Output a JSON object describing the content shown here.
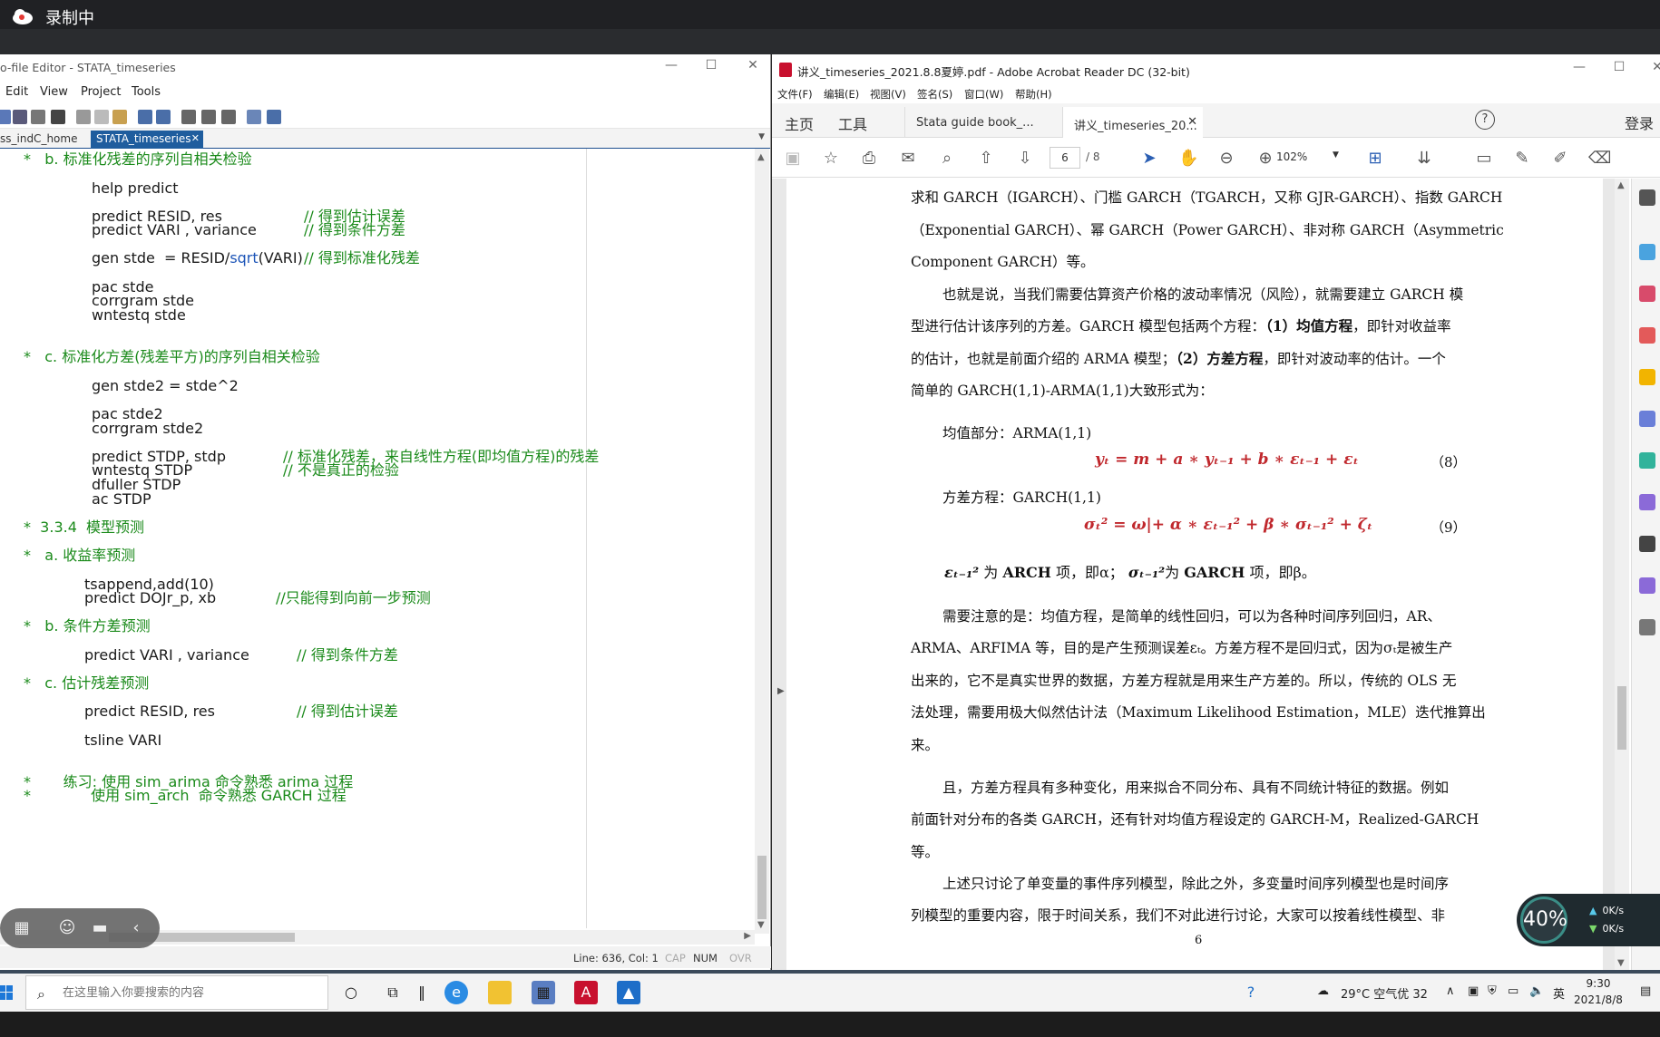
{
  "recording": {
    "status": "录制中"
  },
  "editor": {
    "title": "o-file Editor - STATA_timeseries",
    "menu": [
      "Edit",
      "View",
      "Project",
      "Tools"
    ],
    "tabs": [
      {
        "label": "ss_indC_home"
      },
      {
        "label": "STATA_timeseries"
      }
    ],
    "status": {
      "position": "Line: 636, Col: 1",
      "cap": "CAP",
      "num": "NUM",
      "ovr": "OVR"
    }
  },
  "code": {
    "l1": "*   b. 标准化残差的序列自相关检验",
    "l2": "help predict",
    "l3a": "predict RESID, res",
    "l3c": "// 得到估计误差",
    "l4a": "predict VARI , variance",
    "l4c": "// 得到条件方差",
    "l5a": "gen stde  = RESID/",
    "l5k": "sqrt",
    "l5b": "(VARI)",
    "l5c": "// 得到标准化残差",
    "l6": "pac stde",
    "l7": "corrgram stde",
    "l8": "wntestq stde",
    "l9": "*   c. 标准化方差(残差平方)的序列自相关检验",
    "l10": "gen stde2 = stde^2",
    "l11": "pac stde2",
    "l12": "corrgram stde2",
    "l13a": "predict STDP, stdp",
    "l13c": "// 标准化残差，来自线性方程(即均值方程)的残差",
    "l14a": "wntestq STDP",
    "l14c": "// 不是真正的检验",
    "l15": "dfuller STDP",
    "l16": "ac STDP",
    "l17": "*  3.3.4  模型预测",
    "l18": "*   a. 收益率预测",
    "l19": "tsappend,add(10)",
    "l20a": "predict DOJr_p, xb",
    "l20c": "//只能得到向前一步预测",
    "l21": "*   b. 条件方差预测",
    "l22a": "predict VARI , variance",
    "l22c": "// 得到条件方差",
    "l23": "*   c. 估计残差预测",
    "l24a": "predict RESID, res",
    "l24c": "// 得到估计误差",
    "l25": "tsline VARI",
    "l26": "*       练习: 使用 sim_arima 命令熟悉 arima 过程",
    "l27": "*             使用 sim_arch  命令熟悉 GARCH 过程"
  },
  "acrobat": {
    "title": "讲义_timeseries_2021.8.8夏婷.pdf - Adobe Acrobat Reader DC (32-bit)",
    "menu": [
      "文件(F)",
      "编辑(E)",
      "视图(V)",
      "签名(S)",
      "窗口(W)",
      "帮助(H)"
    ],
    "nav_home": "主页",
    "nav_tools": "工具",
    "tabs": [
      {
        "label": "Stata guide book_..."
      },
      {
        "label": "讲义_timeseries_20..."
      }
    ],
    "login": "登录",
    "page_current": "6",
    "page_total": "/ 8",
    "zoom": "102%"
  },
  "pdf": {
    "p1": "求和 GARCH（IGARCH）、门槛 GARCH（TGARCH，又称 GJR-GARCH）、指数 GARCH",
    "p2": "（Exponential GARCH）、幂 GARCH（Power GARCH）、非对称 GARCH（Asymmetric",
    "p3": "Component GARCH）等。",
    "p4": "也就是说，当我们需要估算资产价格的波动率情况（风险），就需要建立 GARCH 模",
    "p5a": "型进行估计该序列的方差。GARCH 模型包括两个方程：",
    "p5b": "（1）均值方程",
    "p5c": "，即针对收益率",
    "p6a": "的估计，也就是前面介绍的 ARMA 模型；",
    "p6b": "（2）方差方程",
    "p6c": "，即针对波动率的估计。一个",
    "p7": "简单的 GARCH(1,1)-ARMA(1,1)大致形式为：",
    "mean_label": "均值部分：ARMA(1,1)",
    "eq8": "yₜ = m + a ∗ yₜ₋₁ + b ∗ εₜ₋₁ +  εₜ",
    "eq8_num": "（8）",
    "var_label": "方差方程：GARCH(1,1)",
    "eq9": "σₜ² = ω|+  α ∗ εₜ₋₁² + β ∗ σₜ₋₁² + ζₜ",
    "eq9_num": "（9）",
    "arch_line_a": "εₜ₋₁²",
    "arch_line_b": "为",
    "arch_line_c": "ARCH",
    "arch_line_d": "项，即α；",
    "arch_line_e": "σₜ₋₁²",
    "arch_line_f": "为",
    "arch_line_g": "GARCH",
    "arch_line_h": "项，即β。",
    "p8": "需要注意的是：均值方程，是简单的线性回归，可以为各种时间序列回归，AR、",
    "p9": "ARMA、ARFIMA 等，目的是产生预测误差εₜ。方差方程不是回归式，因为σₜ是被生产",
    "p10": "出来的，它不是真实世界的数据，方差方程就是用来生产方差的。所以，传统的 OLS 无",
    "p11": "法处理，需要用极大似然估计法（Maximum Likelihood Estimation，MLE）迭代推算出",
    "p12": "来。",
    "p13": "且，方差方程具有多种变化，用来拟合不同分布、具有不同统计特征的数据。例如",
    "p14": "前面针对分布的各类 GARCH，还有针对均值方程设定的 GARCH-M，Realized-GARCH",
    "p15": "等。",
    "p16": "上述只讨论了单变量的事件序列模型，除此之外，多变量时间序列模型也是时间序",
    "p17": "列模型的重要内容，限于时间关系，我们不对此进行讨论，大家可以按着线性模型、非",
    "page_number": "6"
  },
  "speed": {
    "percent": "40%",
    "up": "0K/s",
    "down": "0K/s"
  },
  "taskbar": {
    "search_placeholder": "在这里输入你要搜索的内容",
    "weather": "29°C  空气优 32",
    "ime": "英",
    "time": "9:30",
    "date": "2021/8/8"
  }
}
